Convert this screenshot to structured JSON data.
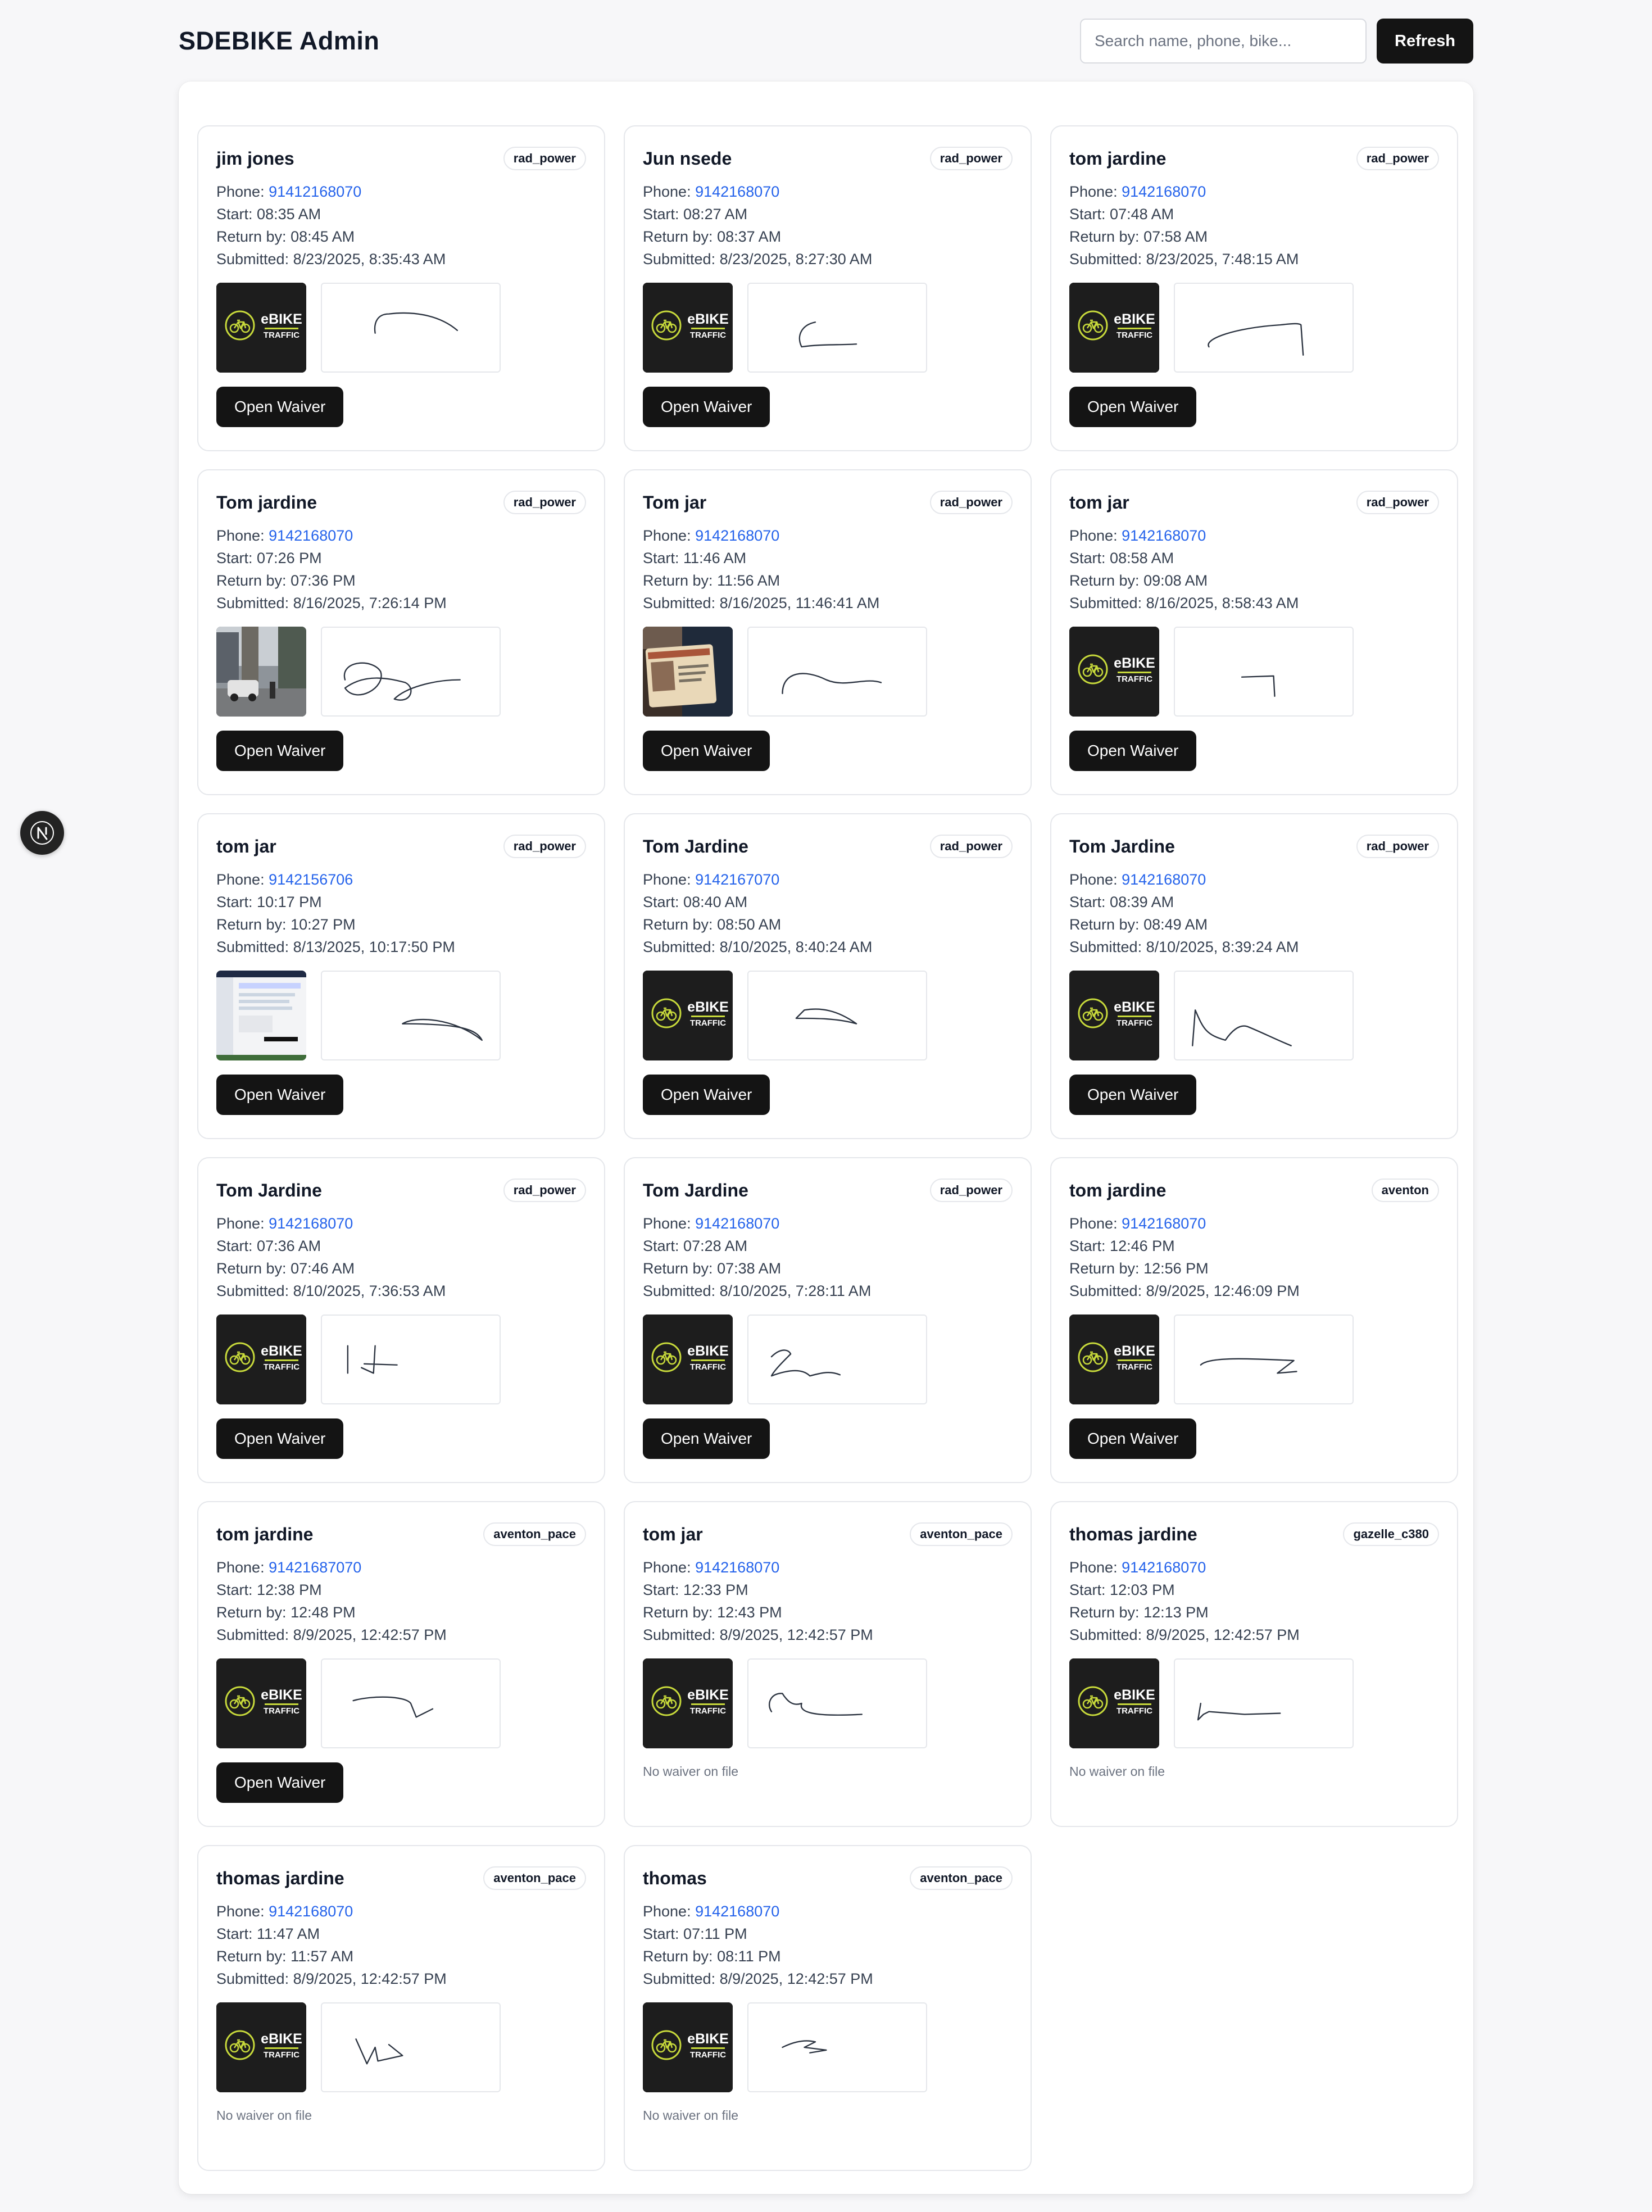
{
  "header": {
    "title": "SDEBIKE Admin",
    "search_placeholder": "Search name, phone, bike...",
    "refresh_label": "Refresh"
  },
  "labels": {
    "phone": "Phone:",
    "start": "Start:",
    "return_by": "Return by:",
    "submitted": "Submitted:",
    "open_waiver": "Open Waiver",
    "no_waiver": "No waiver on file",
    "logo_line1": "eBIKE",
    "logo_line2": "TRAFFIC"
  },
  "colors": {
    "accent_link": "#2563eb",
    "button_dark": "#141414",
    "logo_green": "#c7d93b"
  },
  "submissions": [
    {
      "name": "jim jones",
      "bike": "rad_power",
      "phone": "91412168070",
      "start": "08:35 AM",
      "return_by": "08:45 AM",
      "submitted": "8/23/2025, 8:35:43 AM",
      "photo": "logo",
      "has_waiver": true
    },
    {
      "name": "Jun nsede",
      "bike": "rad_power",
      "phone": "9142168070",
      "start": "08:27 AM",
      "return_by": "08:37 AM",
      "submitted": "8/23/2025, 8:27:30 AM",
      "photo": "logo",
      "has_waiver": true
    },
    {
      "name": "tom jardine",
      "bike": "rad_power",
      "phone": "9142168070",
      "start": "07:48 AM",
      "return_by": "07:58 AM",
      "submitted": "8/23/2025, 7:48:15 AM",
      "photo": "logo",
      "has_waiver": true
    },
    {
      "name": "Tom jardine",
      "bike": "rad_power",
      "phone": "9142168070",
      "start": "07:26 PM",
      "return_by": "07:36 PM",
      "submitted": "8/16/2025, 7:26:14 PM",
      "photo": "street",
      "has_waiver": true
    },
    {
      "name": "Tom jar",
      "bike": "rad_power",
      "phone": "9142168070",
      "start": "11:46 AM",
      "return_by": "11:56 AM",
      "submitted": "8/16/2025, 11:46:41 AM",
      "photo": "id-card",
      "has_waiver": true
    },
    {
      "name": "tom jar",
      "bike": "rad_power",
      "phone": "9142168070",
      "start": "08:58 AM",
      "return_by": "09:08 AM",
      "submitted": "8/16/2025, 8:58:43 AM",
      "photo": "logo",
      "has_waiver": true
    },
    {
      "name": "tom jar",
      "bike": "rad_power",
      "phone": "9142156706",
      "start": "10:17 PM",
      "return_by": "10:27 PM",
      "submitted": "8/13/2025, 10:17:50 PM",
      "photo": "screenshot",
      "has_waiver": true
    },
    {
      "name": "Tom Jardine",
      "bike": "rad_power",
      "phone": "9142167070",
      "start": "08:40 AM",
      "return_by": "08:50 AM",
      "submitted": "8/10/2025, 8:40:24 AM",
      "photo": "logo",
      "has_waiver": true
    },
    {
      "name": "Tom Jardine",
      "bike": "rad_power",
      "phone": "9142168070",
      "start": "08:39 AM",
      "return_by": "08:49 AM",
      "submitted": "8/10/2025, 8:39:24 AM",
      "photo": "logo",
      "has_waiver": true
    },
    {
      "name": "Tom Jardine",
      "bike": "rad_power",
      "phone": "9142168070",
      "start": "07:36 AM",
      "return_by": "07:46 AM",
      "submitted": "8/10/2025, 7:36:53 AM",
      "photo": "logo",
      "has_waiver": true
    },
    {
      "name": "Tom Jardine",
      "bike": "rad_power",
      "phone": "9142168070",
      "start": "07:28 AM",
      "return_by": "07:38 AM",
      "submitted": "8/10/2025, 7:28:11 AM",
      "photo": "logo",
      "has_waiver": true
    },
    {
      "name": "tom jardine",
      "bike": "aventon",
      "phone": "9142168070",
      "start": "12:46 PM",
      "return_by": "12:56 PM",
      "submitted": "8/9/2025, 12:46:09 PM",
      "photo": "logo",
      "has_waiver": true
    },
    {
      "name": "tom jardine",
      "bike": "aventon_pace",
      "phone": "91421687070",
      "start": "12:38 PM",
      "return_by": "12:48 PM",
      "submitted": "8/9/2025, 12:42:57 PM",
      "photo": "logo",
      "has_waiver": true
    },
    {
      "name": "tom jar",
      "bike": "aventon_pace",
      "phone": "9142168070",
      "start": "12:33 PM",
      "return_by": "12:43 PM",
      "submitted": "8/9/2025, 12:42:57 PM",
      "photo": "logo",
      "has_waiver": false
    },
    {
      "name": "thomas jardine",
      "bike": "gazelle_c380",
      "phone": "9142168070",
      "start": "12:03 PM",
      "return_by": "12:13 PM",
      "submitted": "8/9/2025, 12:42:57 PM",
      "photo": "logo",
      "has_waiver": false
    },
    {
      "name": "thomas jardine",
      "bike": "aventon_pace",
      "phone": "9142168070",
      "start": "11:47 AM",
      "return_by": "11:57 AM",
      "submitted": "8/9/2025, 12:42:57 PM",
      "photo": "logo",
      "has_waiver": false
    },
    {
      "name": "thomas",
      "bike": "aventon_pace",
      "phone": "9142168070",
      "start": "07:11 PM",
      "return_by": "08:11 PM",
      "submitted": "8/9/2025, 12:42:57 PM",
      "photo": "logo",
      "has_waiver": false
    }
  ]
}
